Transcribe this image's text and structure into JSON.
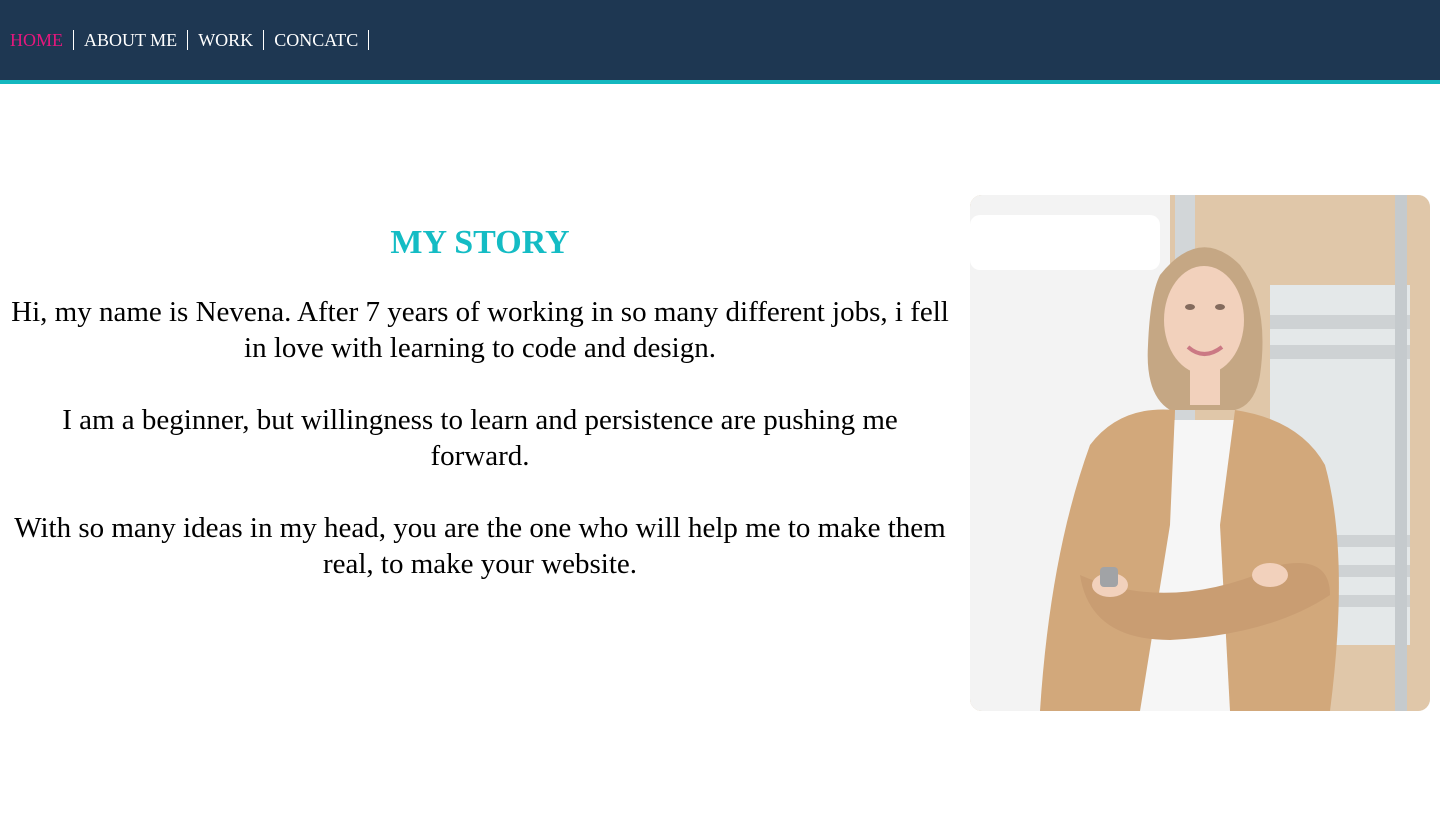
{
  "nav": {
    "items": [
      {
        "label": "HOME",
        "active": true
      },
      {
        "label": "ABOUT ME",
        "active": false
      },
      {
        "label": "WORK",
        "active": false
      },
      {
        "label": "CONCATC",
        "active": false
      }
    ]
  },
  "story": {
    "title": "MY STORY",
    "paragraphs": [
      "Hi, my name is Nevena. After 7 years of working in so many different jobs, i fell in love with learning to code and design.",
      "I am a beginner, but willingness to learn and persistence are pushing me forward.",
      "With so many ideas in my head, you are the one who will help me to make them real, to make your website."
    ]
  },
  "colors": {
    "navbar_bg": "#1e3752",
    "accent_teal": "#14b8bf",
    "active_pink": "#e6177d"
  }
}
